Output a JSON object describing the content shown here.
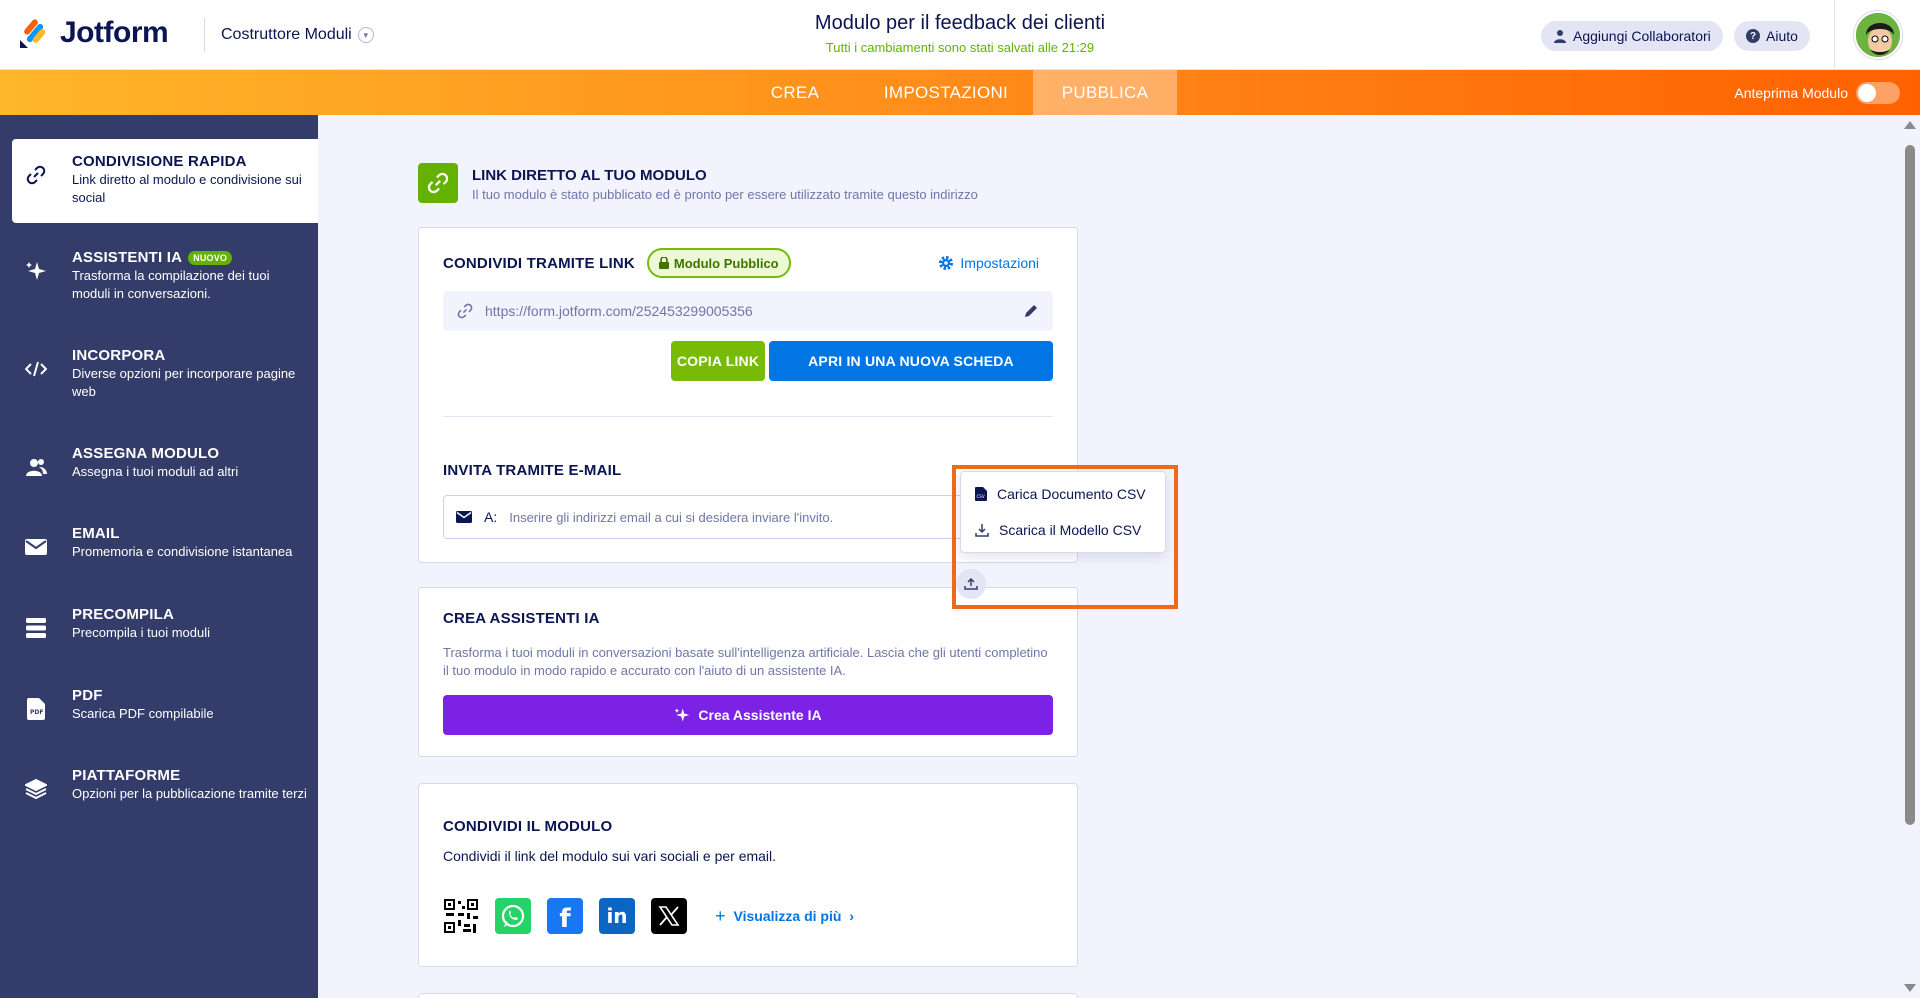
{
  "header": {
    "logo_text": "Jotform",
    "builder_label": "Costruttore Moduli",
    "form_title": "Modulo per il feedback dei clienti",
    "saved_status": "Tutti i cambiamenti sono stati salvati alle 21:29",
    "add_collaborators": "Aggiungi Collaboratori",
    "help": "Aiuto"
  },
  "nav": {
    "tabs": [
      {
        "label": "CREA"
      },
      {
        "label": "IMPOSTAZIONI"
      },
      {
        "label": "PUBBLICA"
      }
    ],
    "preview_label": "Anteprima Modulo"
  },
  "sidebar": {
    "items": [
      {
        "title": "CONDIVISIONE RAPIDA",
        "desc": "Link diretto al modulo e condivisione sui social"
      },
      {
        "title": "ASSISTENTI IA",
        "badge": "NUOVO",
        "desc": "Trasforma la compilazione dei tuoi moduli in conversazioni."
      },
      {
        "title": "INCORPORA",
        "desc": "Diverse opzioni per incorporare pagine web"
      },
      {
        "title": "ASSEGNA MODULO",
        "desc": "Assegna i tuoi moduli ad altri"
      },
      {
        "title": "EMAIL",
        "desc": "Promemoria e condivisione istantanea"
      },
      {
        "title": "PRECOMPILA",
        "desc": "Precompila i tuoi moduli"
      },
      {
        "title": "PDF",
        "desc": "Scarica PDF compilabile"
      },
      {
        "title": "PIATTAFORME",
        "desc": "Opzioni per la pubblicazione tramite terzi"
      }
    ]
  },
  "main": {
    "header_title": "LINK DIRETTO AL TUO MODULO",
    "header_sub": "Il tuo modulo è stato pubblicato ed è pronto per essere utilizzato tramite questo indirizzo",
    "share_link": {
      "title": "CONDIVIDI TRAMITE LINK",
      "public_badge": "Modulo Pubblico",
      "settings": "Impostazioni",
      "url": "https://form.jotform.com/252453299005356",
      "copy_btn": "COPIA LINK",
      "open_btn": "APRI IN UNA NUOVA SCHEDA"
    },
    "invite": {
      "title": "INVITA TRAMITE E-MAIL",
      "to_label": "A:",
      "placeholder": "Inserire gli indirizzi email a cui si desidera inviare l'invito."
    },
    "csv_menu": {
      "upload": "Carica Documento CSV",
      "download": "Scarica il Modello CSV"
    },
    "ai_card": {
      "title": "CREA ASSISTENTI IA",
      "desc": "Trasforma i tuoi moduli in conversazioni basate sull'intelligenza artificiale. Lascia che gli utenti completino il tuo modulo in modo rapido e accurato con l'aiuto di un assistente IA.",
      "button": "Crea Assistente IA"
    },
    "share_card": {
      "title": "CONDIVIDI IL MODULO",
      "desc": "Condividi il link del modulo sui vari sociali e per email.",
      "more": "Visualizza di più"
    }
  },
  "colors": {
    "navy": "#0a1551",
    "sidebar": "#343c6a",
    "green": "#64b200",
    "blue": "#0075e3",
    "purple": "#7b22e4",
    "orange_highlight": "#ec6a1b"
  }
}
